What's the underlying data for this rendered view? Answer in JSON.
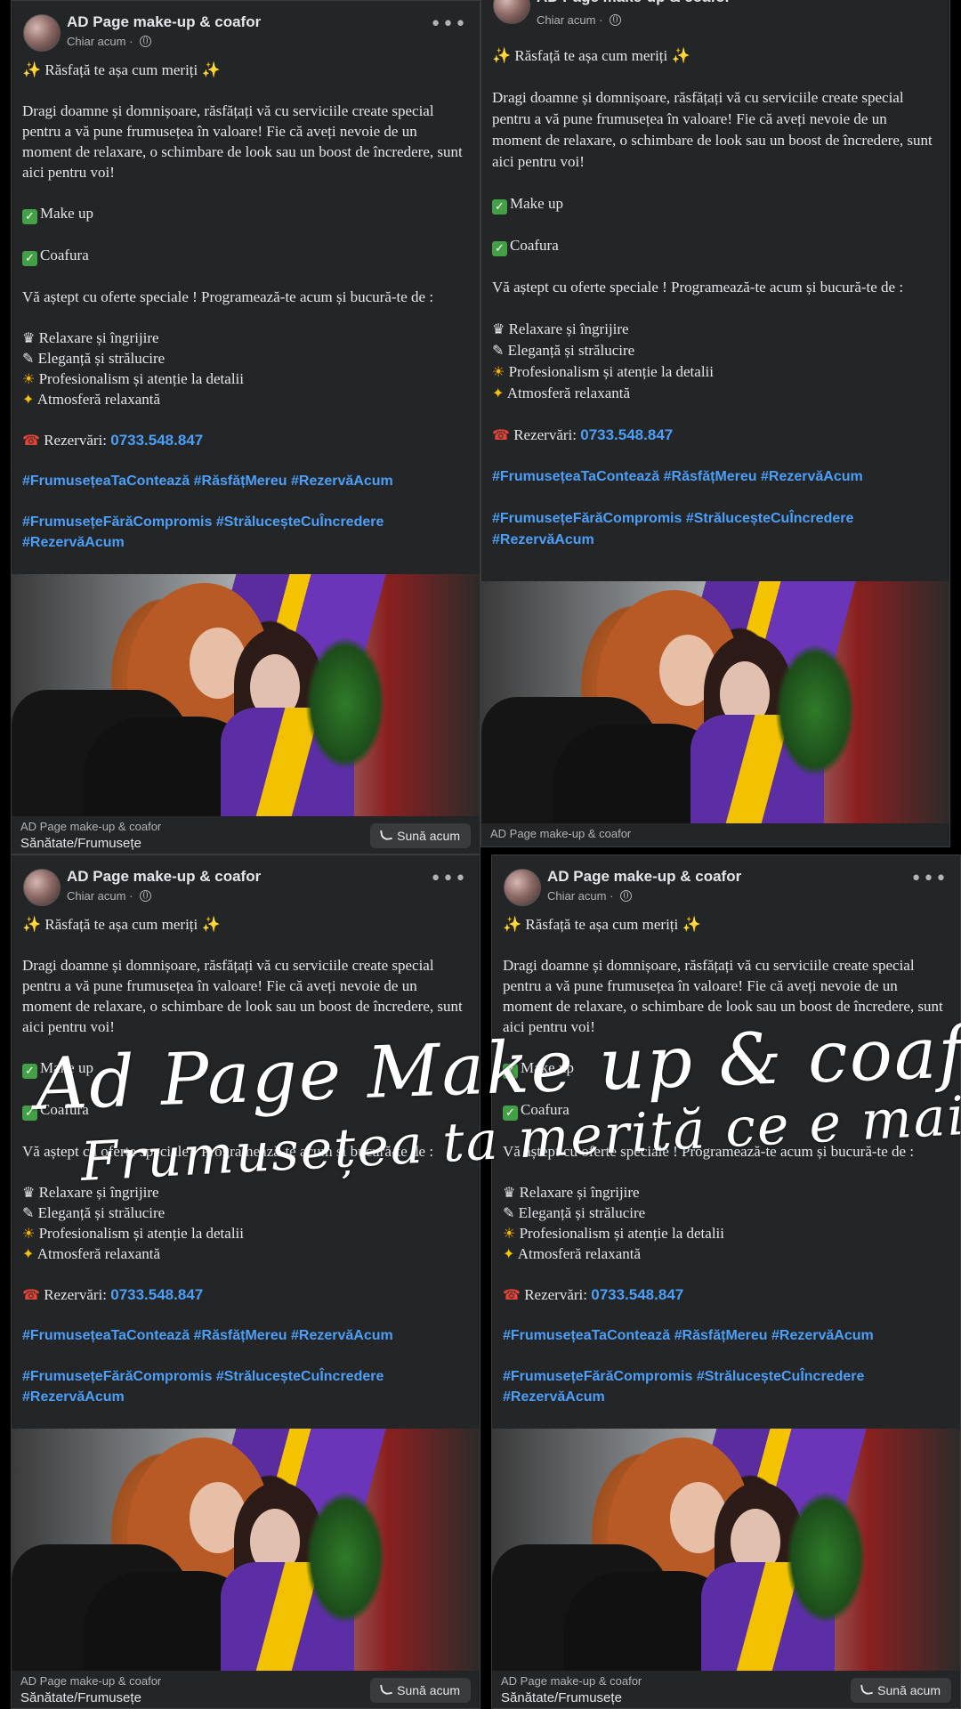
{
  "post": {
    "page_name": "AD Page make-up & coafor",
    "time": "Chiar acum",
    "title_line": "✨ Răsfață te așa cum meriți ✨",
    "intro": "Dragi doamne și domnișoare,  răsfățați vă cu serviciile create special pentru a vă pune frumusețea în valoare! Fie că aveți nevoie de un moment de relaxare, o schimbare de look sau un boost de încredere, sunt aici pentru voi!",
    "service1": "Make up",
    "service2": "Coafura",
    "offer": "Vă aștept cu oferte speciale ! Programează-te acum și bucură-te de :",
    "benefit1": "Relaxare și îngrijire",
    "benefit2": "Eleganță și strălucire",
    "benefit3": "Profesionalism și atenție la detalii",
    "benefit4": "Atmosferă relaxantă",
    "reservations_label": "Rezervări:",
    "phone": "0733.548.847",
    "tags1": "#FrumusețeaTaContează #RăsfățMereu #RezervăAcum",
    "tags2": "#FrumusețeFărăCompromis #StrăluceșteCuÎncredere",
    "tags3": "#RezervăAcum",
    "footer_source": "AD Page make-up & coafor",
    "footer_category": "Sănătate/Frumusețe",
    "call_button": "Sună acum"
  },
  "icons": {
    "more": "more-options-icon",
    "privacy": "globe-icon",
    "phone": "phone-icon",
    "check": "check-icon"
  },
  "overlay": {
    "line1": "Ad Page Make up & coafor",
    "line2": "Frumusețea ta merită ce e mai bun !"
  },
  "colors": {
    "panel_bg": "#242526",
    "link": "#4b9ff8",
    "text": "#e4e6eb",
    "muted": "#b0b3b8"
  }
}
